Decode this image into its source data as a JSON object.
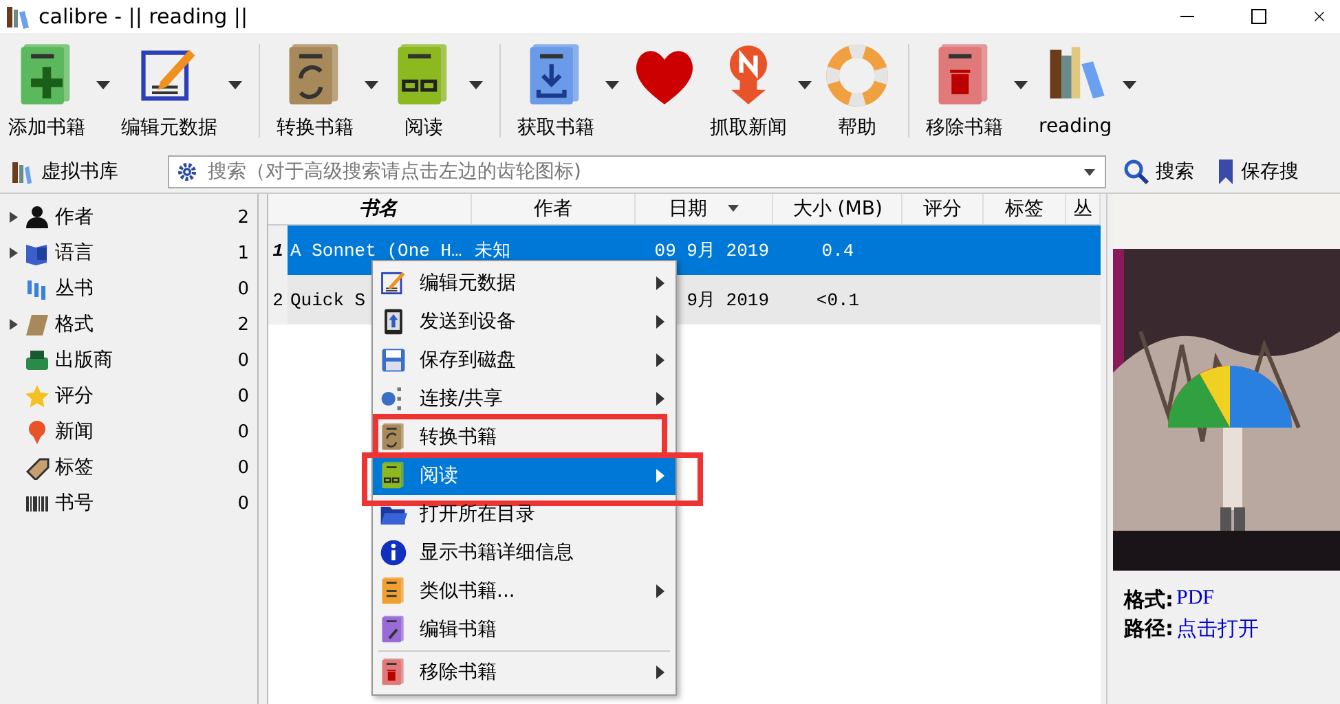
{
  "window": {
    "title": "calibre - || reading ||"
  },
  "toolbar": [
    {
      "label": "添加书籍",
      "dropdown": true,
      "separator_after": false
    },
    {
      "label": "编辑元数据",
      "dropdown": true,
      "separator_after": true
    },
    {
      "label": "转换书籍",
      "dropdown": true,
      "separator_after": false
    },
    {
      "label": "阅读",
      "dropdown": true,
      "separator_after": true
    },
    {
      "label": "获取书籍",
      "dropdown": true,
      "separator_after": false
    },
    {
      "dropdown": false,
      "separator_after": false
    },
    {
      "label": "抓取新闻",
      "dropdown": true,
      "separator_after": false
    },
    {
      "label": "帮助",
      "dropdown": false,
      "separator_after": true
    },
    {
      "label": "移除书籍",
      "dropdown": true,
      "separator_after": false
    },
    {
      "label": "reading",
      "dropdown": true,
      "separator_after": false
    }
  ],
  "searchbar": {
    "virtual_library": "虚拟书库",
    "placeholder": "搜索（对于高级搜索请点击左边的齿轮图标)",
    "search_button": "搜索",
    "save_button": "保存搜"
  },
  "sidebar": {
    "items": [
      {
        "label": "作者",
        "count": "2",
        "expandable": true
      },
      {
        "label": "语言",
        "count": "1",
        "expandable": true
      },
      {
        "label": "丛书",
        "count": "0",
        "expandable": false
      },
      {
        "label": "格式",
        "count": "2",
        "expandable": true
      },
      {
        "label": "出版商",
        "count": "0",
        "expandable": false
      },
      {
        "label": "评分",
        "count": "0",
        "expandable": false
      },
      {
        "label": "新闻",
        "count": "0",
        "expandable": false
      },
      {
        "label": "标签",
        "count": "0",
        "expandable": false
      },
      {
        "label": "书号",
        "count": "0",
        "expandable": false
      }
    ]
  },
  "table": {
    "columns": [
      {
        "label": "书名",
        "sorted": false
      },
      {
        "label": "作者",
        "sorted": false
      },
      {
        "label": "日期",
        "sorted": true
      },
      {
        "label": "大小 (MB)",
        "sorted": false
      },
      {
        "label": "评分",
        "sorted": false
      },
      {
        "label": "标签",
        "sorted": false
      },
      {
        "label": "丛",
        "sorted": false
      }
    ],
    "rows": [
      {
        "number": "1",
        "selected": true,
        "cells": [
          "A Sonnet (One H…",
          "未知",
          "09 9月 2019",
          "0.4"
        ]
      },
      {
        "number": "2",
        "selected": false,
        "cells": [
          "Quick S",
          "",
          "9月 2019",
          "<0.1"
        ]
      }
    ]
  },
  "context_menu": {
    "items": [
      {
        "label": "编辑元数据",
        "submenu": true,
        "selected": false,
        "annotated": false,
        "separator_before": false
      },
      {
        "label": "发送到设备",
        "submenu": true,
        "selected": false,
        "annotated": false,
        "separator_before": false
      },
      {
        "label": "保存到磁盘",
        "submenu": true,
        "selected": false,
        "annotated": false,
        "separator_before": false
      },
      {
        "label": "连接/共享",
        "submenu": true,
        "selected": false,
        "annotated": false,
        "separator_before": false
      },
      {
        "label": "转换书籍",
        "submenu": false,
        "selected": false,
        "annotated": true,
        "separator_before": false
      },
      {
        "label": "阅读",
        "submenu": true,
        "selected": true,
        "annotated": true,
        "separator_before": false
      },
      {
        "label": "打开所在目录",
        "submenu": false,
        "selected": false,
        "annotated": false,
        "separator_before": false
      },
      {
        "label": "显示书籍详细信息",
        "submenu": false,
        "selected": false,
        "annotated": false,
        "separator_before": false
      },
      {
        "label": "类似书籍...",
        "submenu": true,
        "selected": false,
        "annotated": false,
        "separator_before": false
      },
      {
        "label": "编辑书籍",
        "submenu": false,
        "selected": false,
        "annotated": false,
        "separator_before": false
      },
      {
        "label": "移除书籍",
        "submenu": true,
        "selected": false,
        "annotated": false,
        "separator_before": true
      }
    ]
  },
  "details": {
    "fields": [
      {
        "label": "格式:",
        "value": "PDF"
      },
      {
        "label": "路径:",
        "value": "点击打开"
      }
    ]
  }
}
